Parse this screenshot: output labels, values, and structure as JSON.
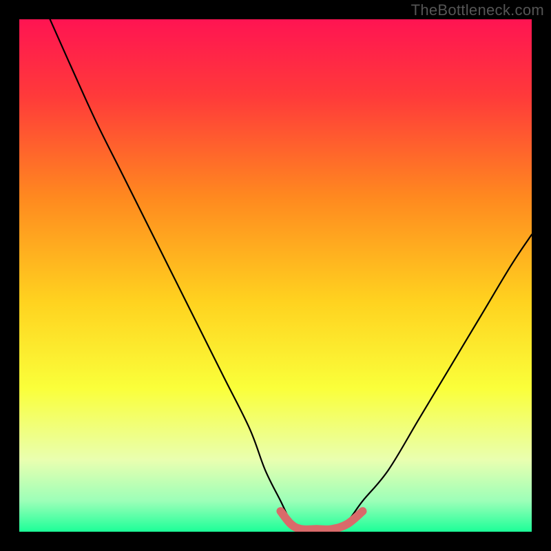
{
  "watermark": "TheBottleneck.com",
  "colors": {
    "frame": "#000000",
    "gradient_stops": [
      {
        "offset": 0.0,
        "color": "#ff1452"
      },
      {
        "offset": 0.15,
        "color": "#ff3a3a"
      },
      {
        "offset": 0.35,
        "color": "#ff8a1f"
      },
      {
        "offset": 0.55,
        "color": "#ffd21f"
      },
      {
        "offset": 0.72,
        "color": "#faff3a"
      },
      {
        "offset": 0.86,
        "color": "#e9ffb0"
      },
      {
        "offset": 0.94,
        "color": "#9cffb8"
      },
      {
        "offset": 1.0,
        "color": "#1cff98"
      }
    ],
    "curve": "#000000",
    "accent": "#d96a6a"
  },
  "chart_data": {
    "type": "line",
    "title": "",
    "xlabel": "",
    "ylabel": "",
    "xlim": [
      0,
      100
    ],
    "ylim": [
      0,
      100
    ],
    "series": [
      {
        "name": "bottleneck-curve",
        "x": [
          6,
          10,
          15,
          20,
          25,
          30,
          35,
          40,
          45,
          48,
          51,
          53,
          55,
          58,
          61,
          64,
          67,
          72,
          78,
          84,
          90,
          96,
          100
        ],
        "y": [
          100,
          91,
          80,
          70,
          60,
          50,
          40,
          30,
          20,
          12,
          6,
          2,
          0,
          0,
          0,
          2,
          6,
          12,
          22,
          32,
          42,
          52,
          58
        ]
      },
      {
        "name": "accent-flat",
        "x": [
          51,
          53,
          55,
          58,
          61,
          64,
          67
        ],
        "y": [
          4,
          1.5,
          0.5,
          0.5,
          0.5,
          1.5,
          4
        ]
      }
    ]
  }
}
